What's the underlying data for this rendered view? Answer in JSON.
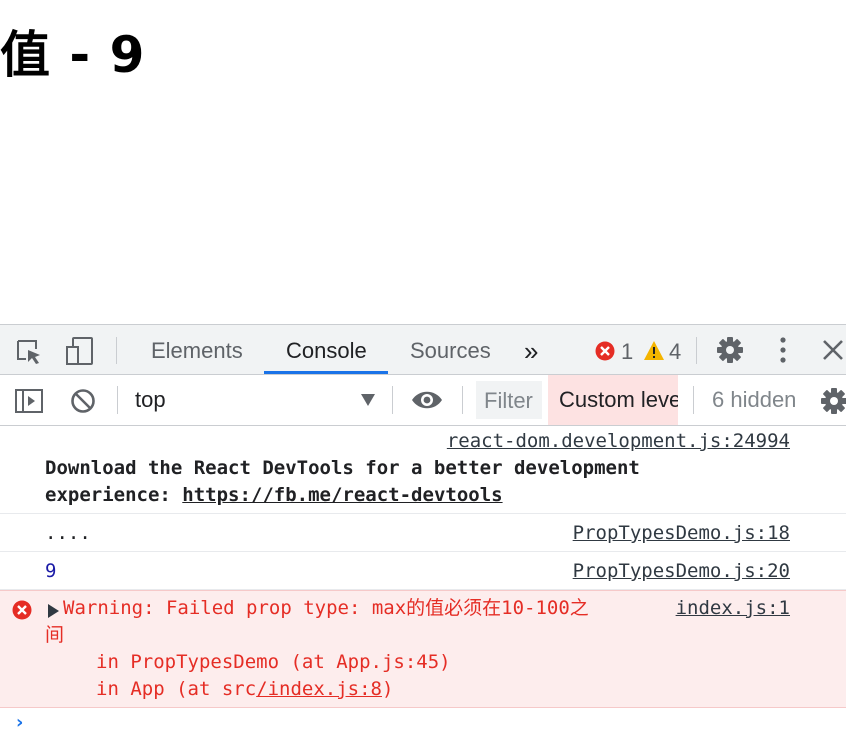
{
  "page": {
    "heading": "值 - 9"
  },
  "devtools": {
    "tabs": [
      "Elements",
      "Console",
      "Sources"
    ],
    "more_tabs": "»",
    "error_count": "1",
    "warning_count": "4",
    "toolbar": {
      "context": "top",
      "filter_placeholder": "Filter",
      "levels": "Custom leve",
      "hidden": "6 hidden"
    },
    "messages": {
      "devtools_source": "react-dom.development.js:24994",
      "devtools_text_1": "Download the React DevTools for a better development",
      "devtools_text_2": "experience: ",
      "devtools_link": "https://fb.me/react-devtools",
      "dots_text": "....",
      "dots_source": "PropTypesDemo.js:18",
      "value_text": "9",
      "value_source": "PropTypesDemo.js:20",
      "warning_line_1": "Warning: Failed prop type: max的值必须在10-100之",
      "warning_line_2": "间",
      "warning_source": "index.js:1",
      "stack_1": "in PropTypesDemo (at App.js:45)",
      "stack_2_prefix": "in App (at src",
      "stack_2_link": "/index.js:8",
      "stack_2_suffix": ")"
    },
    "colors": {
      "accent": "#1a73e8",
      "error": "#e52d25",
      "warning_bg": "#fdeded",
      "warning_icon": "#f4b400"
    }
  }
}
